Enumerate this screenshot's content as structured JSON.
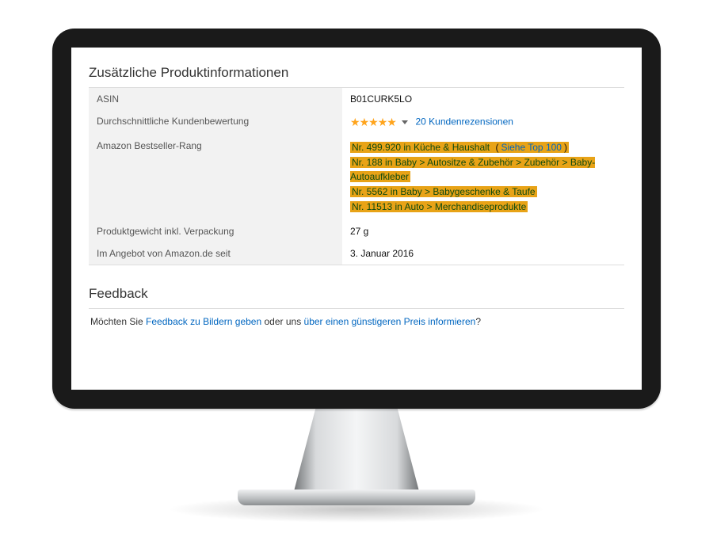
{
  "sections": {
    "product_info_title": "Zusätzliche Produktinformationen",
    "feedback_title": "Feedback"
  },
  "rows": {
    "asin": {
      "label": "ASIN",
      "value": "B01CURK5LO"
    },
    "rating": {
      "label": "Durchschnittliche Kundenbewertung",
      "reviews_link": "20 Kundenrezensionen"
    },
    "rank": {
      "label": "Amazon Bestseller-Rang",
      "main_prefix": "Nr. 499.920 in Küche & Haushalt ",
      "main_paren_open": "(",
      "main_link": "Siehe Top 100",
      "main_paren_close": ")",
      "sub1": "Nr. 188 in Baby > Autositze & Zubehör > Zubehör > Baby-Autoaufkleber",
      "sub2": "Nr. 5562 in Baby > Babygeschenke & Taufe",
      "sub3": "Nr. 11513 in Auto > Merchandiseprodukte"
    },
    "weight": {
      "label": "Produktgewicht inkl. Verpackung",
      "value": "27 g"
    },
    "since": {
      "label": "Im Angebot von Amazon.de seit",
      "value": "3. Januar 2016"
    }
  },
  "feedback": {
    "pre": "Möchten Sie ",
    "link1": "Feedback zu Bildern geben",
    "mid": " oder uns ",
    "link2": "über einen günstigeren Preis informieren",
    "post": "?"
  }
}
